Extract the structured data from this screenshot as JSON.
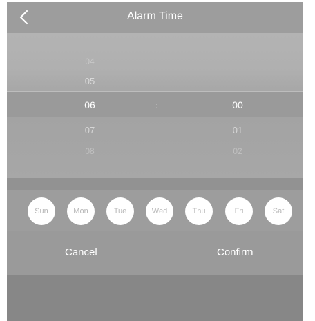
{
  "header": {
    "title": "Alarm Time"
  },
  "picker": {
    "hours": {
      "above_far": "04",
      "above": "05",
      "selected": "06",
      "below": "07",
      "below_far": "08"
    },
    "separator": ":",
    "minutes": {
      "selected": "00",
      "below": "01",
      "below_far": "02"
    }
  },
  "days": [
    "Sun",
    "Mon",
    "Tue",
    "Wed",
    "Thu",
    "Fri",
    "Sat"
  ],
  "actions": {
    "cancel_label": "Cancel",
    "confirm_label": "Confirm"
  },
  "colors": {
    "overlay": "#8c8c8c",
    "text": "#ffffff",
    "day_chip": "#ffffff",
    "day_text": "#b8b8b8"
  }
}
